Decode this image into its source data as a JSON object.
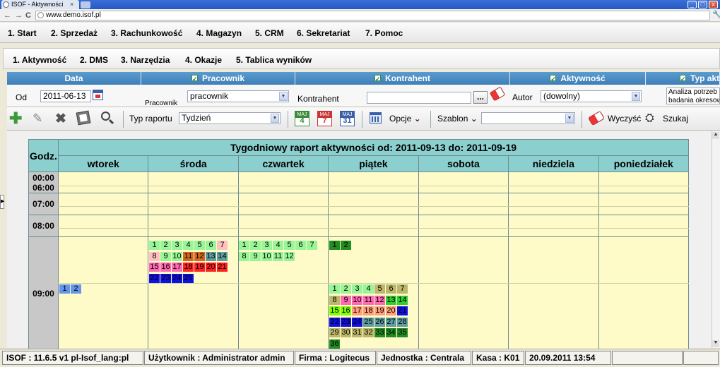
{
  "browser": {
    "tab_title": "ISOF - Aktywności",
    "url": "www.demo.isof.pl",
    "close_tab": "×",
    "back": "←",
    "forward": "→",
    "reload": "C",
    "wrench": "🔧",
    "min": "_",
    "max": "□",
    "close": "x"
  },
  "main_menu": [
    "1. Start",
    "2. Sprzedaż",
    "3. Rachunkowość",
    "4. Magazyn",
    "5. CRM",
    "6. Sekretariat",
    "7. Pomoc"
  ],
  "sub_menu": [
    "1. Aktywność",
    "2. DMS",
    "3. Narzędzia",
    "4. Okazje",
    "5. Tablica wyników"
  ],
  "filters": {
    "data_header": "Data",
    "pracownik_header": "Pracownik",
    "kontrahent_header": "Kontrahent",
    "aktywnosc_header": "Aktywność",
    "typ_header": "Typ akt",
    "od_label": "Od",
    "od_value": "2011-06-13",
    "pracownik_label": "Pracownik",
    "pracownik_value": "pracownik",
    "kontrahent_label": "Kontrahent",
    "kontrahent_value": "",
    "kontrahent_btn": "...",
    "autor_label": "Autor",
    "autor_value": "(dowolny)",
    "typ_text_1": "Analiza potrzeb",
    "typ_text_2": "badania okresow"
  },
  "toolbar": {
    "typ_raportu_label": "Typ raportu",
    "typ_raportu_value": "Tydzień",
    "cal_4": "MAJ 4",
    "cal_7": "MAJ 7",
    "cal_31": "MAJ 31",
    "opcje_label": "Opcje",
    "szablon_label": "Szablon",
    "szablon_value": "",
    "wyczysc_label": "Wyczyść",
    "szukaj_label": "Szukaj"
  },
  "calendar": {
    "godz_label": "Godz.",
    "title": "Tygodniowy raport aktywności od: 2011-09-13 do: 2011-09-19",
    "days": [
      "wtorek",
      "środa",
      "czwartek",
      "piątek",
      "sobota",
      "niedziela",
      "poniedziałek"
    ],
    "hours": [
      "00:00",
      "06:00",
      "07:00",
      "08:00",
      "09:00"
    ],
    "blocks": {
      "wtorek": [
        {
          "n": "1",
          "c": "#6495ed"
        },
        {
          "n": "2",
          "c": "#6495ed"
        }
      ],
      "sroda": [
        {
          "n": "1",
          "c": "#98f598"
        },
        {
          "n": "2",
          "c": "#98f598"
        },
        {
          "n": "3",
          "c": "#98f598"
        },
        {
          "n": "4",
          "c": "#98f598"
        },
        {
          "n": "5",
          "c": "#98f598"
        },
        {
          "n": "6",
          "c": "#98f598"
        },
        {
          "n": "7",
          "c": "#ffc0c0"
        },
        {
          "n": "8",
          "c": "#ffc0c0"
        },
        {
          "n": "9",
          "c": "#98f598"
        },
        {
          "n": "10",
          "c": "#98f598"
        },
        {
          "n": "11",
          "c": "#d2691e"
        },
        {
          "n": "12",
          "c": "#d2691e"
        },
        {
          "n": "13",
          "c": "#5f9ea0"
        },
        {
          "n": "14",
          "c": "#5f9ea0"
        },
        {
          "n": "15",
          "c": "#ff69b4"
        },
        {
          "n": "16",
          "c": "#ff69b4"
        },
        {
          "n": "17",
          "c": "#ff69b4"
        },
        {
          "n": "18",
          "c": "#ff2020"
        },
        {
          "n": "19",
          "c": "#ff2020"
        },
        {
          "n": "20",
          "c": "#ff2020"
        },
        {
          "n": "21",
          "c": "#ff2020"
        },
        {
          "n": "22",
          "c": "#1010e0"
        },
        {
          "n": "23",
          "c": "#1010e0"
        },
        {
          "n": "24",
          "c": "#1010e0"
        },
        {
          "n": "25",
          "c": "#1010e0"
        }
      ],
      "czwartek": [
        {
          "n": "1",
          "c": "#98f598"
        },
        {
          "n": "2",
          "c": "#98f598"
        },
        {
          "n": "3",
          "c": "#98f598"
        },
        {
          "n": "4",
          "c": "#98f598"
        },
        {
          "n": "5",
          "c": "#98f598"
        },
        {
          "n": "6",
          "c": "#98f598"
        },
        {
          "n": "7",
          "c": "#98f598"
        },
        {
          "n": "8",
          "c": "#98f598"
        },
        {
          "n": "9",
          "c": "#98f598"
        },
        {
          "n": "10",
          "c": "#98f598"
        },
        {
          "n": "11",
          "c": "#98f598"
        },
        {
          "n": "12",
          "c": "#98f598"
        }
      ],
      "piatek_top": [
        {
          "n": "1",
          "c": "#228b22"
        },
        {
          "n": "2",
          "c": "#228b22"
        }
      ],
      "piatek": [
        {
          "n": "1",
          "c": "#98f598"
        },
        {
          "n": "2",
          "c": "#98f598"
        },
        {
          "n": "3",
          "c": "#98f598"
        },
        {
          "n": "4",
          "c": "#98f598"
        },
        {
          "n": "5",
          "c": "#bdb76b"
        },
        {
          "n": "6",
          "c": "#bdb76b"
        },
        {
          "n": "7",
          "c": "#bdb76b"
        },
        {
          "n": "8",
          "c": "#bdb76b"
        },
        {
          "n": "9",
          "c": "#ff69b4"
        },
        {
          "n": "10",
          "c": "#ff69b4"
        },
        {
          "n": "11",
          "c": "#ff69b4"
        },
        {
          "n": "12",
          "c": "#ff69b4"
        },
        {
          "n": "13",
          "c": "#32cd32"
        },
        {
          "n": "14",
          "c": "#32cd32"
        },
        {
          "n": "15",
          "c": "#7fff00"
        },
        {
          "n": "16",
          "c": "#7fff00"
        },
        {
          "n": "17",
          "c": "#ffa07a"
        },
        {
          "n": "18",
          "c": "#ffa07a"
        },
        {
          "n": "19",
          "c": "#ffa07a"
        },
        {
          "n": "20",
          "c": "#ffa07a"
        },
        {
          "n": "21",
          "c": "#1010e0"
        },
        {
          "n": "22",
          "c": "#1010e0"
        },
        {
          "n": "23",
          "c": "#1010e0"
        },
        {
          "n": "24",
          "c": "#1010e0"
        },
        {
          "n": "25",
          "c": "#5f9ea0"
        },
        {
          "n": "26",
          "c": "#5f9ea0"
        },
        {
          "n": "27",
          "c": "#5f9ea0"
        },
        {
          "n": "28",
          "c": "#5f9ea0"
        },
        {
          "n": "29",
          "c": "#bdb76b"
        },
        {
          "n": "30",
          "c": "#bdb76b"
        },
        {
          "n": "31",
          "c": "#bdb76b"
        },
        {
          "n": "32",
          "c": "#bdb76b"
        },
        {
          "n": "33",
          "c": "#228b22"
        },
        {
          "n": "34",
          "c": "#228b22"
        },
        {
          "n": "35",
          "c": "#228b22"
        },
        {
          "n": "36",
          "c": "#228b22"
        }
      ]
    }
  },
  "status": {
    "version": "ISOF : 11.6.5 v1 pl-Isof_lang:pl",
    "user": "Użytkownik : Administrator admin",
    "firma": "Firma : Logitecus",
    "jednostka": "Jednostka : Centrala",
    "kasa": "Kasa : K01",
    "datetime": "20.09.2011 13:54"
  }
}
